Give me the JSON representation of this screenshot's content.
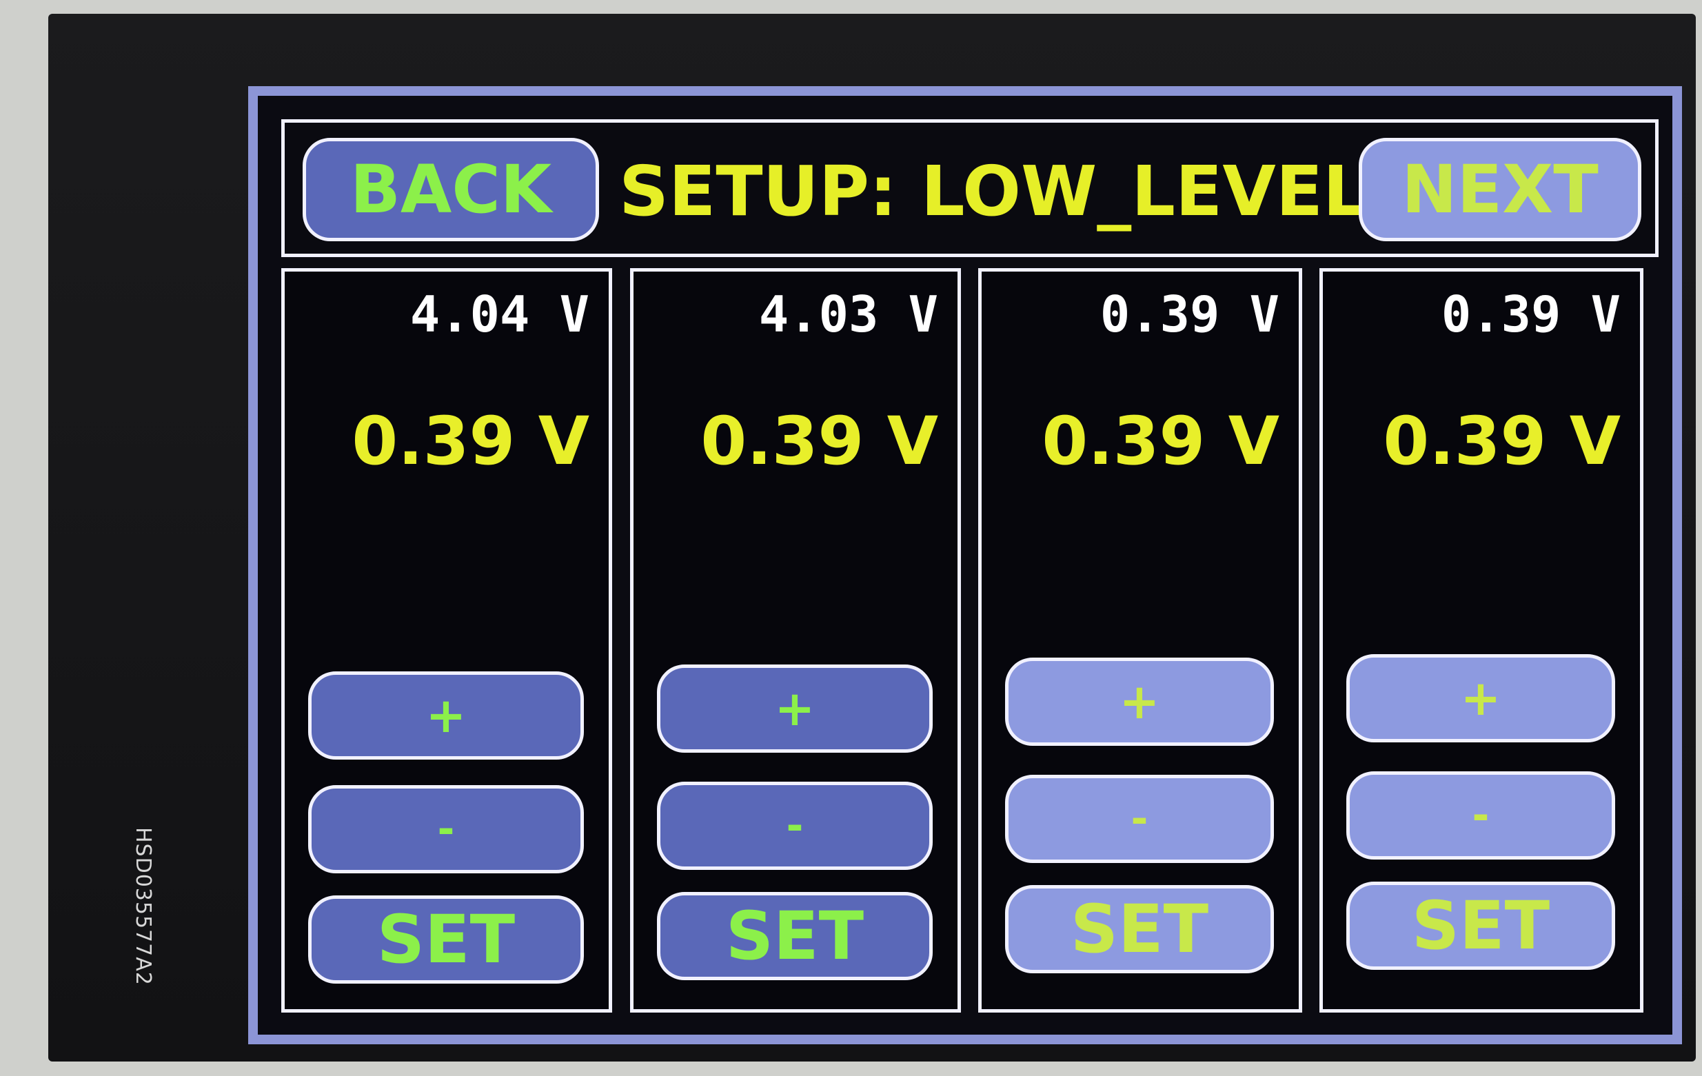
{
  "panel_label": "HSD035577A2",
  "header": {
    "back_label": "BACK",
    "title": "SETUP: LOW_LEVEL",
    "next_label": "NEXT"
  },
  "channels": [
    {
      "measured": "4.04 V",
      "setpoint": "0.39 V",
      "plus_label": "+",
      "minus_label": "-",
      "set_label": "SET"
    },
    {
      "measured": "4.03 V",
      "setpoint": "0.39 V",
      "plus_label": "+",
      "minus_label": "-",
      "set_label": "SET"
    },
    {
      "measured": "0.39 V",
      "setpoint": "0.39 V",
      "plus_label": "+",
      "minus_label": "-",
      "set_label": "SET"
    },
    {
      "measured": "0.39 V",
      "setpoint": "0.39 V",
      "plus_label": "+",
      "minus_label": "-",
      "set_label": "SET"
    }
  ],
  "colors": {
    "button_fill": "#5a68b8",
    "button_fill_light": "#8d9ae0",
    "button_text": "#8cf04a",
    "title_text": "#e6ef28",
    "border": "#f1f1ff"
  }
}
